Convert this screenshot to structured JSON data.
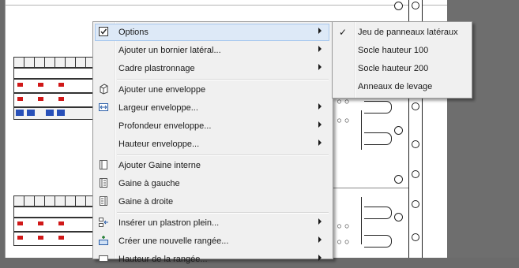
{
  "context_menu": {
    "items": [
      {
        "label": "Options",
        "icon": "options-checkbox-icon",
        "submenu": true,
        "highlighted": true
      },
      {
        "label": "Ajouter un bornier latéral...",
        "icon": "",
        "submenu": true
      },
      {
        "label": "Cadre plastronnage",
        "icon": "",
        "submenu": true
      },
      {
        "label": "Ajouter une enveloppe",
        "icon": "enclosure-icon",
        "submenu": false
      },
      {
        "label": "Largeur enveloppe...",
        "icon": "width-icon",
        "submenu": true
      },
      {
        "label": "Profondeur enveloppe...",
        "icon": "",
        "submenu": true
      },
      {
        "label": "Hauteur enveloppe...",
        "icon": "",
        "submenu": true
      },
      {
        "label": "Ajouter Gaine interne",
        "icon": "duct-icon",
        "submenu": false
      },
      {
        "label": "Gaine à gauche",
        "icon": "duct-left-icon",
        "submenu": false
      },
      {
        "label": "Gaine à droite",
        "icon": "duct-right-icon",
        "submenu": false
      },
      {
        "label": "Insérer un plastron plein...",
        "icon": "plate-icon",
        "submenu": true
      },
      {
        "label": "Créer une nouvelle rangée...",
        "icon": "new-row-icon",
        "submenu": true
      },
      {
        "label": "Hauteur de la rangée...",
        "icon": "row-height-icon",
        "submenu": true
      }
    ]
  },
  "options_submenu": {
    "items": [
      {
        "label": "Jeu de panneaux latéraux",
        "checked": true
      },
      {
        "label": "Socle hauteur 100",
        "checked": false
      },
      {
        "label": "Socle hauteur 200",
        "checked": false
      },
      {
        "label": "Anneaux de levage",
        "checked": false
      }
    ]
  },
  "colors": {
    "menu_bg": "#f0f0f0",
    "highlight": "#dde9f7",
    "highlight_border": "#a8c8ee",
    "breaker_red": "#d01818",
    "module_blue": "#2850b8",
    "app_bg": "#6b6b6b"
  }
}
